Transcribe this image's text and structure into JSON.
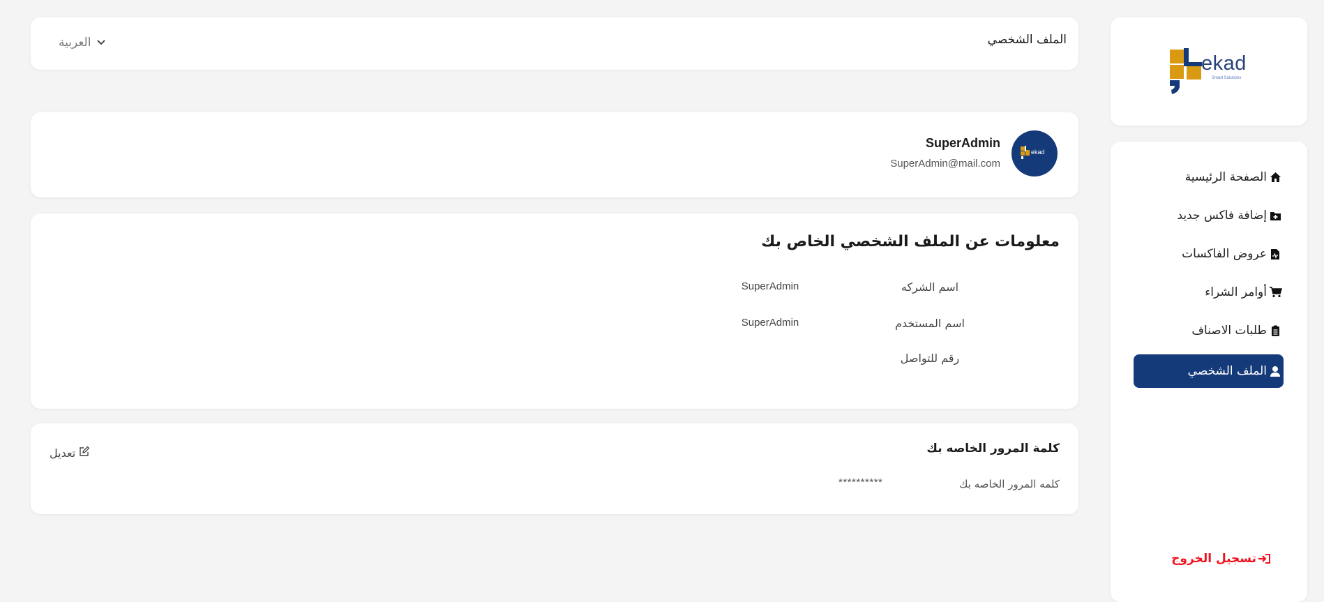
{
  "header": {
    "title": "الملف الشخصي",
    "language": "العربية"
  },
  "brand": {
    "name": "ekad",
    "tagline": "Smart Solutions",
    "primary_color": "#153a7a",
    "accent_color": "#d99a12"
  },
  "sidebar": {
    "items": [
      {
        "label": "الصفحة الرئيسية",
        "icon": "home-icon",
        "active": false
      },
      {
        "label": "إضافة فاكس جديد",
        "icon": "folder-plus-icon",
        "active": false
      },
      {
        "label": "عروض الفاكسات",
        "icon": "file-chart-icon",
        "active": false
      },
      {
        "label": "أوامر الشراء",
        "icon": "cart-icon",
        "active": false
      },
      {
        "label": "طلبات الاصناف",
        "icon": "clipboard-list-icon",
        "active": false
      },
      {
        "label": "الملف الشخصي",
        "icon": "user-icon",
        "active": true
      }
    ],
    "logout": {
      "label": "تسجيل الخروج",
      "icon": "logout-icon",
      "color": "#f0141e"
    }
  },
  "profile": {
    "name": "SuperAdmin",
    "email": "SuperAdmin@mail.com"
  },
  "info": {
    "title": "معلومات عن الملف الشخصي الخاص بك",
    "rows": [
      {
        "label": "اسم الشركه",
        "value": "SuperAdmin"
      },
      {
        "label": "اسم المستخدم",
        "value": "SuperAdmin"
      },
      {
        "label": "رقم للتواصل",
        "value": ""
      }
    ]
  },
  "password": {
    "title": "كلمة المرور الخاصه بك",
    "label": "كلمه المرور الخاصه بك",
    "value": "**********",
    "edit_label": "تعديل"
  }
}
